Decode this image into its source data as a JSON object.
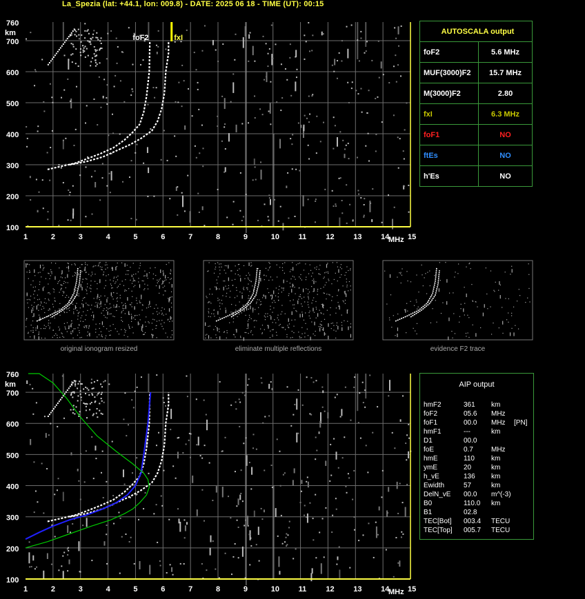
{
  "header": {
    "title": "La_Spezia (lat: +44.1, lon: 009.8) - DATE: 2025 06 18 - TIME (UT): 00:15"
  },
  "colors": {
    "axis": "#ffff44",
    "grid": "#6e6e6e",
    "panel_border": "#3a9a3a",
    "nh_profile": "#2020ff",
    "model_profile": "#00cc00",
    "foF2": "#ffffff",
    "fxI": "#c8c800",
    "foF1": "#ff2020",
    "ftEs": "#2f8fff",
    "hEs": "#ffffff"
  },
  "autoscala": {
    "title": "AUTOSCALA output",
    "rows": [
      {
        "label": "foF2",
        "value": "5.6 MHz",
        "color": "#ffffff"
      },
      {
        "label": "MUF(3000)F2",
        "value": "15.7 MHz",
        "color": "#ffffff"
      },
      {
        "label": "M(3000)F2",
        "value": "2.80",
        "color": "#ffffff"
      },
      {
        "label": "fxI",
        "value": "6.3 MHz",
        "color": "#c8c800"
      },
      {
        "label": "foF1",
        "value": "NO",
        "color": "#ff2020"
      },
      {
        "label": "ftEs",
        "value": "NO",
        "color": "#2f8fff"
      },
      {
        "label": "h'Es",
        "value": "NO",
        "color": "#ffffff"
      }
    ]
  },
  "aip": {
    "title": "AIP output",
    "rows": [
      [
        "hmF2",
        "361",
        "km",
        ""
      ],
      [
        "foF2",
        "05.6",
        "MHz",
        ""
      ],
      [
        "foF1",
        "00.0",
        "MHz",
        "[PN]"
      ],
      [
        "hmF1",
        "---",
        "km",
        ""
      ],
      [
        "D1",
        "00.0",
        "",
        ""
      ],
      [
        "foE",
        "0.7",
        "MHz",
        ""
      ],
      [
        "hmE",
        "110",
        "km",
        ""
      ],
      [
        "ymE",
        "20",
        "km",
        ""
      ],
      [
        "h_vE",
        "136",
        "km",
        ""
      ],
      [
        "Ewidth",
        "57",
        "km",
        ""
      ],
      [
        "DelN_vE",
        "00.0",
        "m^(-3)",
        ""
      ],
      [
        "B0",
        "110.0",
        "km",
        ""
      ],
      [
        "B1",
        "02.8",
        "",
        ""
      ],
      [
        "TEC[Bot]",
        "003.4",
        "TECU",
        ""
      ],
      [
        "TEC[Top]",
        "005.7",
        "TECU",
        ""
      ]
    ]
  },
  "captions": {
    "thumb1": "original ionogram resized",
    "thumb2": "eliminate multiple reflections",
    "thumb3": "evidence F2 trace"
  },
  "chart_data": [
    {
      "type": "scatter",
      "id": "ionogram-top",
      "title": "",
      "xlabel": "MHz",
      "ylabel": "km",
      "xlim": [
        1,
        15
      ],
      "ylim": [
        100,
        760
      ],
      "xticks": [
        1,
        2,
        3,
        4,
        5,
        6,
        7,
        8,
        9,
        10,
        11,
        12,
        13,
        14,
        15
      ],
      "yticks": [
        100,
        200,
        300,
        400,
        500,
        600,
        700,
        760
      ],
      "grid": true,
      "markers": [
        {
          "label": "foF2",
          "x": 5.6
        },
        {
          "label": "fxI",
          "x": 6.3
        }
      ],
      "traces": {
        "o_trace": {
          "x": [
            1.8,
            2.3,
            2.8,
            3.2,
            3.7,
            4.2,
            4.6,
            4.9,
            5.15,
            5.3,
            5.4,
            5.5,
            5.52
          ],
          "y": [
            285,
            295,
            305,
            318,
            335,
            355,
            380,
            405,
            430,
            470,
            520,
            600,
            700
          ]
        },
        "x_trace": {
          "x": [
            2.6,
            3.2,
            3.8,
            4.3,
            4.8,
            5.2,
            5.6,
            5.8,
            5.95,
            6.05,
            6.1,
            6.2,
            6.2
          ],
          "y": [
            300,
            310,
            325,
            345,
            365,
            385,
            410,
            440,
            480,
            530,
            600,
            660,
            700
          ]
        }
      }
    },
    {
      "type": "line",
      "id": "ionogram-bottom",
      "title": "",
      "xlabel": "MHz",
      "ylabel": "km",
      "xlim": [
        1,
        15
      ],
      "ylim": [
        100,
        760
      ],
      "xticks": [
        1,
        2,
        3,
        4,
        5,
        6,
        7,
        8,
        9,
        10,
        11,
        12,
        13,
        14,
        15
      ],
      "yticks": [
        100,
        200,
        300,
        400,
        500,
        600,
        700,
        760
      ],
      "grid": true,
      "series": [
        {
          "name": "",
          "x": [
            1,
            1.5,
            2,
            2.6,
            3.2,
            3.8,
            4.3,
            4.7,
            5.0,
            5.2,
            5.3,
            5.45,
            5.55
          ],
          "y": [
            228,
            250,
            270,
            290,
            305,
            325,
            345,
            370,
            400,
            440,
            500,
            600,
            700
          ]
        },
        {
          "name": "",
          "x": [
            1,
            1.8,
            2.6,
            3.4,
            4.1,
            4.6,
            4.9,
            5.15,
            5.4,
            5.5,
            5.45,
            5.3,
            4.9,
            4.3,
            3.6,
            3.0,
            2.5,
            2.0,
            1.5,
            1.1
          ],
          "y": [
            200,
            220,
            245,
            270,
            290,
            310,
            325,
            345,
            370,
            395,
            420,
            440,
            470,
            510,
            560,
            620,
            680,
            730,
            770,
            790
          ]
        }
      ]
    }
  ]
}
